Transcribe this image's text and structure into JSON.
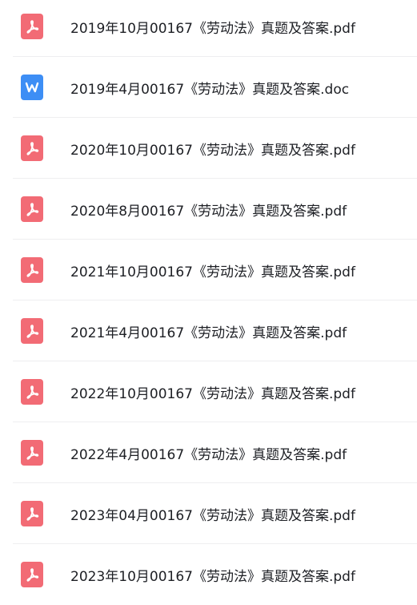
{
  "colors": {
    "pdf_icon": "#f26b75",
    "doc_icon": "#3d8ef5",
    "text": "#1d1f24",
    "divider": "#eeeef0"
  },
  "files": [
    {
      "name": "2019年10月00167《劳动法》真题及答案.pdf",
      "type": "pdf",
      "icon": "pdf-icon"
    },
    {
      "name": "2019年4月00167《劳动法》真题及答案.doc",
      "type": "doc",
      "icon": "word-doc-icon"
    },
    {
      "name": "2020年10月00167《劳动法》真题及答案.pdf",
      "type": "pdf",
      "icon": "pdf-icon"
    },
    {
      "name": "2020年8月00167《劳动法》真题及答案.pdf",
      "type": "pdf",
      "icon": "pdf-icon"
    },
    {
      "name": "2021年10月00167《劳动法》真题及答案.pdf",
      "type": "pdf",
      "icon": "pdf-icon"
    },
    {
      "name": "2021年4月00167《劳动法》真题及答案.pdf",
      "type": "pdf",
      "icon": "pdf-icon"
    },
    {
      "name": "2022年10月00167《劳动法》真题及答案.pdf",
      "type": "pdf",
      "icon": "pdf-icon"
    },
    {
      "name": "2022年4月00167《劳动法》真题及答案.pdf",
      "type": "pdf",
      "icon": "pdf-icon"
    },
    {
      "name": "2023年04月00167《劳动法》真题及答案.pdf",
      "type": "pdf",
      "icon": "pdf-icon"
    },
    {
      "name": "2023年10月00167《劳动法》真题及答案.pdf",
      "type": "pdf",
      "icon": "pdf-icon"
    }
  ]
}
